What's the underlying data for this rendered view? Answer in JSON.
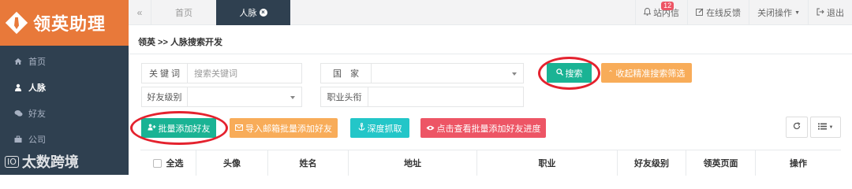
{
  "sidebar": {
    "logo_text": "领英助理",
    "items": [
      {
        "label": "首页",
        "icon": "home-icon",
        "active": false
      },
      {
        "label": "人脉",
        "icon": "user-icon",
        "active": true
      },
      {
        "label": "好友",
        "icon": "comments-icon",
        "active": false
      },
      {
        "label": "公司",
        "icon": "briefcase-icon",
        "active": false
      }
    ],
    "watermark": "太数跨境"
  },
  "topbar": {
    "tabs": [
      {
        "label": "首页",
        "active": false
      },
      {
        "label": "人脉",
        "active": true
      }
    ],
    "right": [
      {
        "label": "站内信",
        "icon": "bell-icon"
      },
      {
        "label": "在线反馈",
        "icon": "edit-icon"
      },
      {
        "label": "关闭操作",
        "icon": "chevron-down-icon"
      },
      {
        "label": "退出",
        "icon": "sign-out-icon"
      }
    ],
    "message_badge": "12"
  },
  "breadcrumb": "领英 >> 人脉搜索开发",
  "filters": {
    "keyword_label": "关 键 词",
    "keyword_placeholder": "搜索关键词",
    "country_label": "国　家",
    "country_value": "",
    "friend_level_label": "好友级别",
    "friend_level_value": "",
    "job_title_label": "职业头衔",
    "job_title_value": ""
  },
  "buttons": {
    "search": "搜索",
    "collapse_filters": "收起精准搜索筛选",
    "batch_add_friends": "批量添加好友",
    "import_email_batch_add": "导入邮箱批量添加好友",
    "deep_crawl": "深度抓取",
    "view_batch_progress": "点击查看批量添加好友进度"
  },
  "table": {
    "columns": [
      "全选",
      "头像",
      "姓名",
      "地址",
      "职业",
      "好友级别",
      "领英页面",
      "操作"
    ]
  },
  "colors": {
    "sidebar_bg": "#2f4050",
    "logo_bg": "#e8793a",
    "primary_green": "#1ab394",
    "warning_orange": "#f8ac59",
    "info_cyan": "#23c6c8",
    "danger_red": "#ed5565",
    "highlight_ring": "#e4222e"
  }
}
